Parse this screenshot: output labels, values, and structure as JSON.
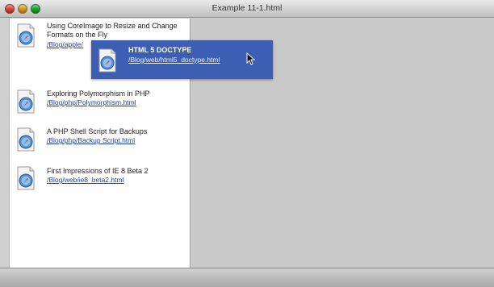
{
  "window": {
    "title": "Example 11-1.html"
  },
  "items": [
    {
      "title_line1": "Using CoreImage to Resize and Change",
      "title_line2": "Formats on the Fly",
      "link": "/Blog/apple/"
    },
    {
      "title_line1": "Exploring Polymorphism in PHP",
      "link": "/Blog/php/Polymorphism.html"
    },
    {
      "title_line1": "A PHP Shell Script for Backups",
      "link": "/Blog/php/Backup Script.html"
    },
    {
      "title_line1": "First Impressions of IE 8 Beta 2",
      "link": "/Blog/web/ie8_beta2.html"
    }
  ],
  "dragged": {
    "title": "HTML 5 DOCTYPE",
    "link": "/Blog/web/html5_doctype.html"
  },
  "icons": {
    "document": "safari-document-icon",
    "cursor": "arrow-cursor-icon"
  },
  "colors": {
    "drag_highlight": "#3d5fb3",
    "link": "#1b3fa8"
  }
}
